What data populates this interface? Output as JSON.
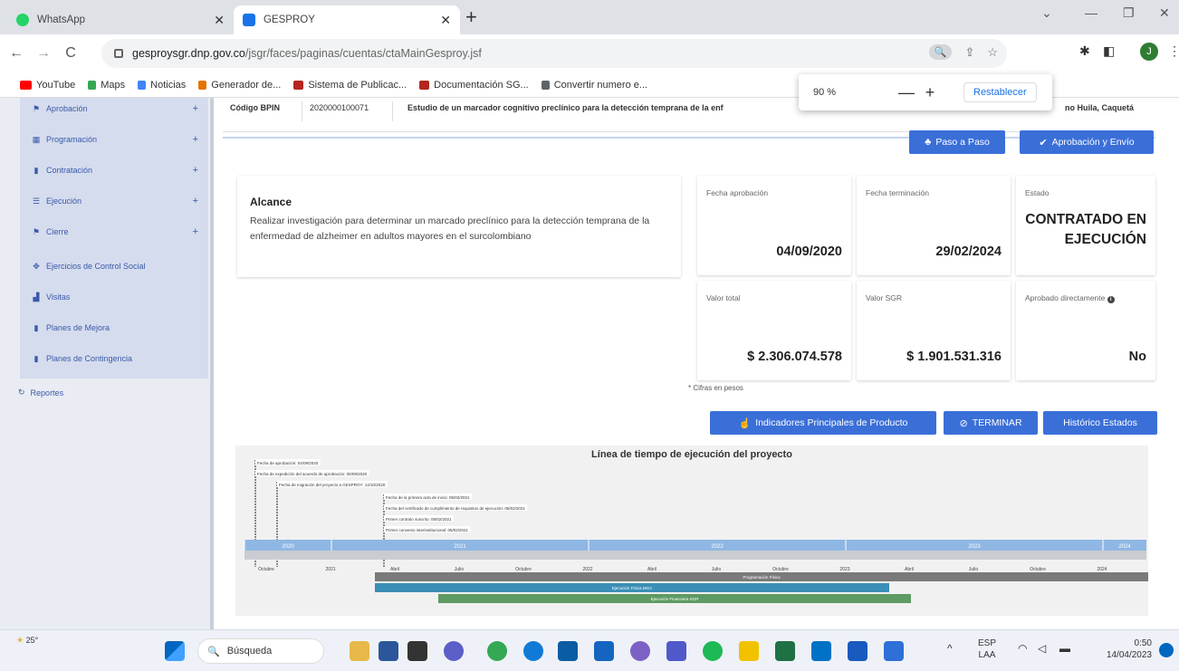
{
  "browser": {
    "tabs": [
      {
        "title": "WhatsApp",
        "active": false,
        "favicon_color": "#25d366"
      },
      {
        "title": "GESPROY",
        "active": true,
        "favicon_color": "#1a73e8"
      }
    ],
    "url_host": "gesproysgr.dnp.gov.co",
    "url_path": "/jsgr/faces/paginas/cuentas/ctaMainGesproy.jsf",
    "bookmarks": [
      {
        "label": "YouTube",
        "color": "#ff0000"
      },
      {
        "label": "Maps",
        "color": "#34a853"
      },
      {
        "label": "Noticias",
        "color": "#4285f4"
      },
      {
        "label": "Generador de...",
        "color": "#e37400"
      },
      {
        "label": "Sistema de Publicac...",
        "color": "#b3261e"
      },
      {
        "label": "Documentación SG...",
        "color": "#b3261e"
      },
      {
        "label": "Convertir numero e...",
        "color": "#5f6368"
      }
    ],
    "zoom_popup": {
      "percent": "90 %",
      "minus": "—",
      "plus": "+",
      "reset": "Restablecer"
    }
  },
  "sidebar": {
    "items": [
      {
        "label": "Aprobación",
        "icon": "flag-icon"
      },
      {
        "label": "Programación",
        "icon": "calendar-icon"
      },
      {
        "label": "Contratación",
        "icon": "document-icon"
      },
      {
        "label": "Ejecución",
        "icon": "list-icon"
      },
      {
        "label": "Cierre",
        "icon": "flag-icon"
      },
      {
        "label": "Ejercicios de Control Social",
        "icon": "users-icon"
      },
      {
        "label": "Visitas",
        "icon": "chart-icon"
      },
      {
        "label": "Planes de Mejora",
        "icon": "document-icon"
      },
      {
        "label": "Planes de Contingencia",
        "icon": "document-icon"
      }
    ],
    "reportes": "Reportes"
  },
  "project_header": {
    "code_label": "Código BPIN",
    "code_value": "2020000100071",
    "name": "Estudio de un marcador cognitivo preclínico para la detección temprana de la enf",
    "location": "no Huila, Caquetá"
  },
  "actions": {
    "paso_a_paso": "Paso a Paso",
    "aprobacion_envio": "Aprobación y Envío",
    "indicadores": "Indicadores Principales de Producto",
    "terminar": "TERMINAR",
    "historico": "Histórico Estados"
  },
  "alcance": {
    "title": "Alcance",
    "text": "Realizar investigación para determinar un marcado preclínico para la detección temprana de la enfermedad de alzheimer en adultos mayores en el surcolombiano"
  },
  "stats": {
    "fecha_aprobacion": {
      "label": "Fecha aprobación",
      "value": "04/09/2020"
    },
    "fecha_terminacion": {
      "label": "Fecha terminación",
      "value": "29/02/2024"
    },
    "estado": {
      "label": "Estado",
      "value": "CONTRATADO EN EJECUCIÓN"
    },
    "valor_total": {
      "label": "Valor total",
      "value": "$ 2.306.074.578"
    },
    "valor_sgr": {
      "label": "Valor SGR",
      "value": "$ 1.901.531.316"
    },
    "aprobado_directamente": {
      "label": "Aprobado directamente",
      "value": "No"
    },
    "note": "* Cifras en pesos"
  },
  "timeline": {
    "title": "Línea de tiempo de ejecución del proyecto",
    "events": [
      "Fecha de aprobación: 04/09/2020",
      "Fecha de expedición del acuerdo de aprobación: 05/09/2020",
      "Fecha de migración del proyecto a GESPROY: 14/10/2020",
      "Fecha de la primera acta de inicio: 05/02/2021",
      "Fecha del certificado de cumplimiento de requisitos de ejecución: 05/02/2021",
      "Primer contrato suscrito: 05/02/2021",
      "Primer convenio interinstitucional: 05/02/2021"
    ],
    "years": [
      "2020",
      "2021",
      "2022",
      "2023",
      "2024"
    ],
    "months": [
      "Octubre",
      "2021",
      "Abril",
      "Julio",
      "Octubre",
      "2022",
      "Abril",
      "Julio",
      "Octubre",
      "2023",
      "Abril",
      "Julio",
      "Octubre",
      "2024"
    ],
    "bars": [
      {
        "label": "Programación Física",
        "color": "#7a7a7a"
      },
      {
        "label": "Ejecución Física MGA",
        "color": "#3b8fb6"
      },
      {
        "label": "Ejecución Financiera SGR",
        "color": "#5e9a63"
      }
    ]
  },
  "taskbar": {
    "weather": "25°",
    "search": "Búsqueda",
    "lang": "ESP",
    "lang_sub": "LAA",
    "time": "0:50",
    "date": "14/04/2023"
  }
}
